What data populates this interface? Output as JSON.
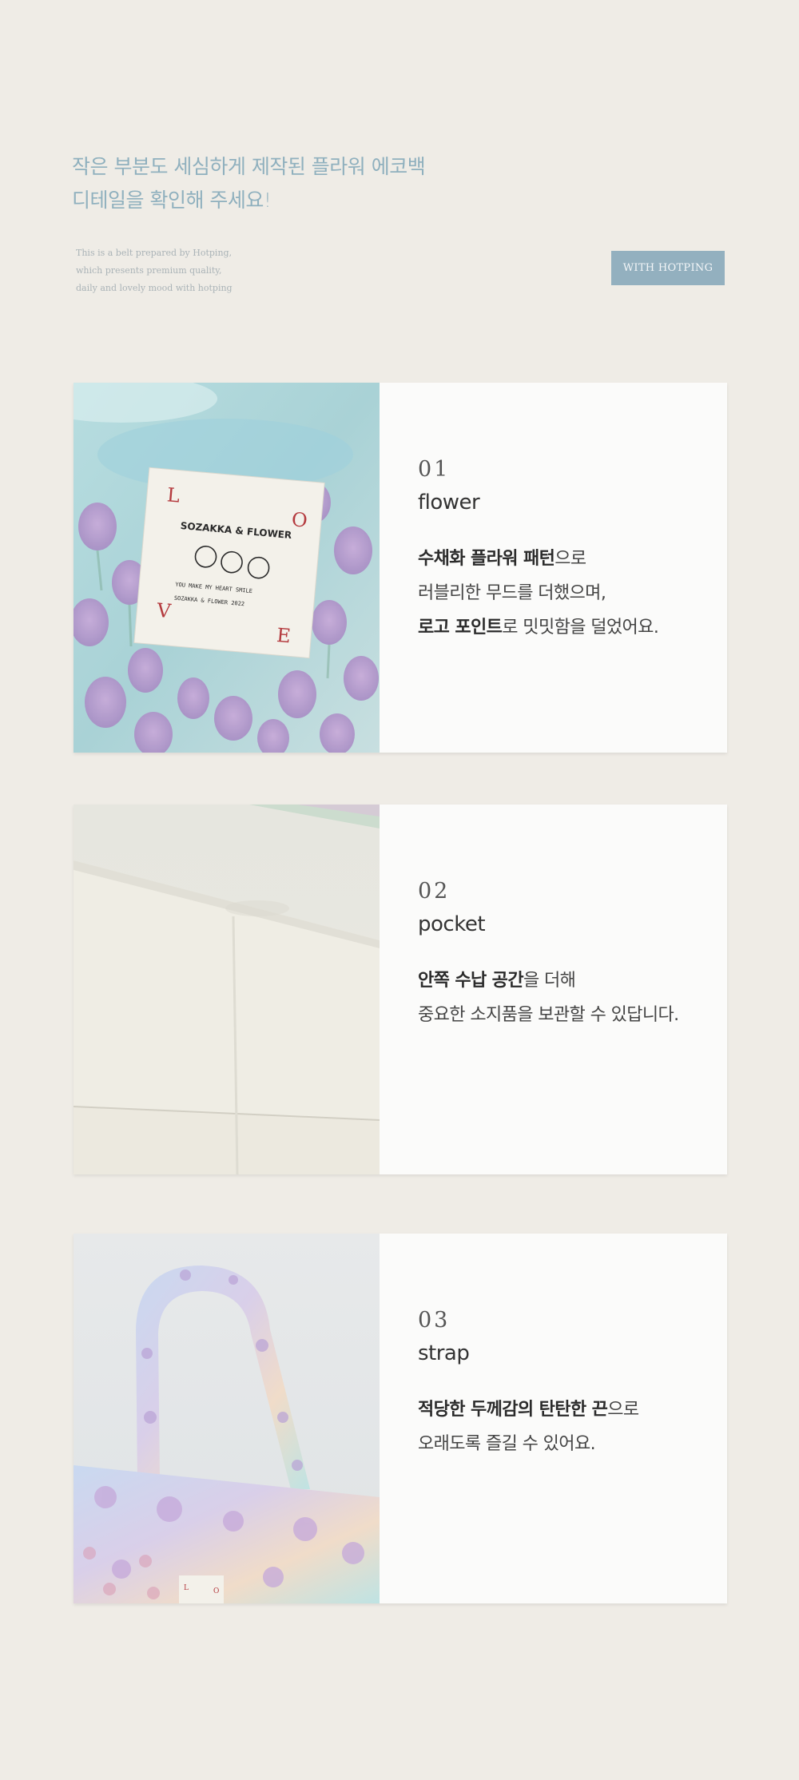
{
  "intro": {
    "title_line1": "작은 부분도 세심하게 제작된 플라워 에코백",
    "title_line2": "디테일을 확인해 주세요!",
    "desc_line1": "This is a belt prepared by Hotping,",
    "desc_line2": "which presents premium quality,",
    "desc_line3": "daily and lovely mood with hotping",
    "badge": "WITH HOTPING"
  },
  "colors": {
    "background": "#efece6",
    "accent": "#93b0bf",
    "title": "#8fb0be"
  },
  "cards": [
    {
      "num": "01",
      "name": "flower",
      "line1_bold": "수채화 플라워 패턴",
      "line1_rest": "으로",
      "line2": "러블리한 무드를 더했으며,",
      "line3_bold": "로고 포인트",
      "line3_rest": "로 밋밋함을 덜었어요.",
      "label": {
        "l": "L",
        "o": "O",
        "v": "V",
        "e": "E",
        "brand": "SOZAKKA & FLOWER",
        "small1": "YOU MAKE MY HEART SMILE",
        "small2": "SOZAKKA & FLOWER 2022"
      }
    },
    {
      "num": "02",
      "name": "pocket",
      "line1_bold": "안쪽 수납 공간",
      "line1_rest": "을 더해",
      "line2": "중요한 소지품을 보관할 수 있답니다."
    },
    {
      "num": "03",
      "name": "strap",
      "line1_bold": "적당한 두께감의 탄탄한 끈",
      "line1_rest": "으로",
      "line2": "오래도록 즐길 수 있어요.",
      "label": {
        "l": "L",
        "o": "O"
      }
    }
  ]
}
